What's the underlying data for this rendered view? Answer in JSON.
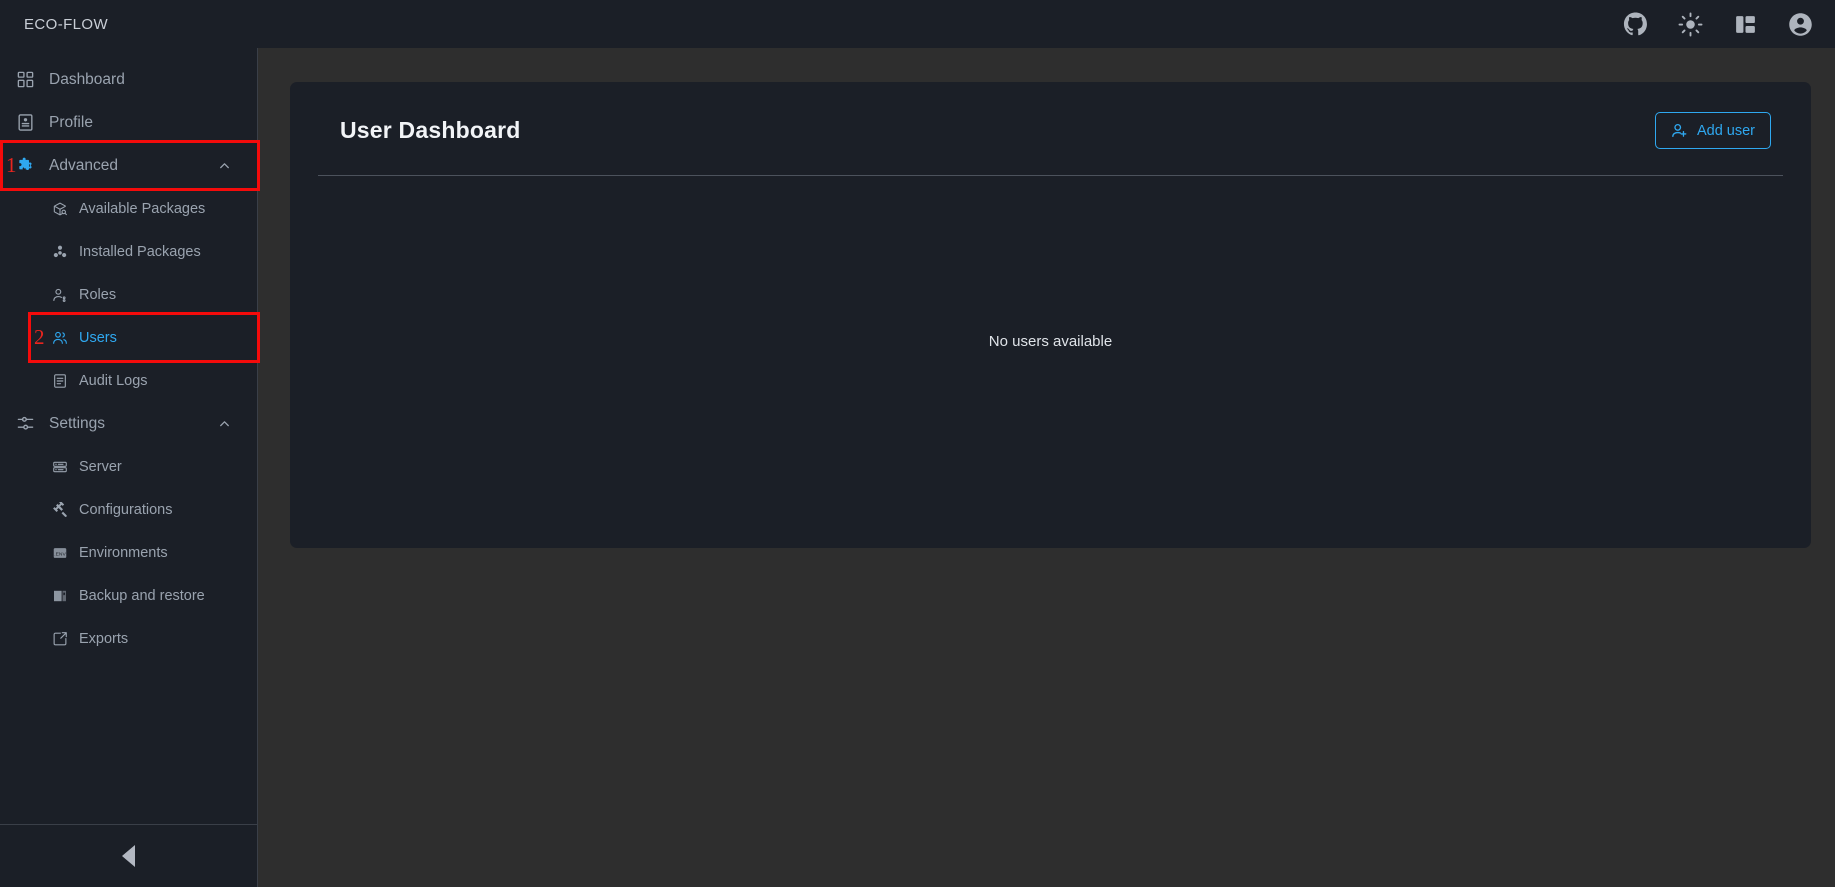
{
  "header": {
    "brand": "ECO-FLOW",
    "icons": [
      {
        "name": "github-icon"
      },
      {
        "name": "sun-theme-icon"
      },
      {
        "name": "layout-panels-icon"
      },
      {
        "name": "user-account-icon"
      }
    ]
  },
  "sidebar": {
    "items": [
      {
        "label": "Dashboard",
        "icon": "dashboard-grid-icon",
        "level": "top",
        "active": false,
        "expandable": false
      },
      {
        "label": "Profile",
        "icon": "profile-card-icon",
        "level": "top",
        "active": false,
        "expandable": false
      },
      {
        "label": "Advanced",
        "icon": "advanced-puzzle-icon",
        "level": "top",
        "active": false,
        "expandable": true,
        "expanded": true,
        "icon_accent": true,
        "annotation": "1"
      },
      {
        "label": "Available Packages",
        "icon": "package-search-icon",
        "level": "child",
        "active": false
      },
      {
        "label": "Installed Packages",
        "icon": "packages-stack-icon",
        "level": "child",
        "active": false
      },
      {
        "label": "Roles",
        "icon": "roles-person-icon",
        "level": "child",
        "active": false
      },
      {
        "label": "Users",
        "icon": "users-group-icon",
        "level": "child",
        "active": true,
        "annotation": "2"
      },
      {
        "label": "Audit Logs",
        "icon": "audit-log-icon",
        "level": "child",
        "active": false
      },
      {
        "label": "Settings",
        "icon": "settings-sliders-icon",
        "level": "top",
        "active": false,
        "expandable": true,
        "expanded": true
      },
      {
        "label": "Server",
        "icon": "server-icon",
        "level": "child",
        "active": false
      },
      {
        "label": "Configurations",
        "icon": "tools-wrench-icon",
        "level": "child",
        "active": false
      },
      {
        "label": "Environments",
        "icon": "env-file-icon",
        "level": "child",
        "active": false
      },
      {
        "label": "Backup and restore",
        "icon": "backup-archive-icon",
        "level": "child",
        "active": false
      },
      {
        "label": "Exports",
        "icon": "export-share-icon",
        "level": "child",
        "active": false
      }
    ],
    "collapse_button": "collapse-sidebar-arrow"
  },
  "main": {
    "card_title": "User Dashboard",
    "add_user_label": "Add user",
    "empty_state": "No users available"
  },
  "colors": {
    "accent": "#2fa8f0",
    "panel_bg": "#1b1f27",
    "page_bg": "#2e2e2e",
    "annotation": "#f50b0b",
    "text_muted": "#9aa3af"
  }
}
